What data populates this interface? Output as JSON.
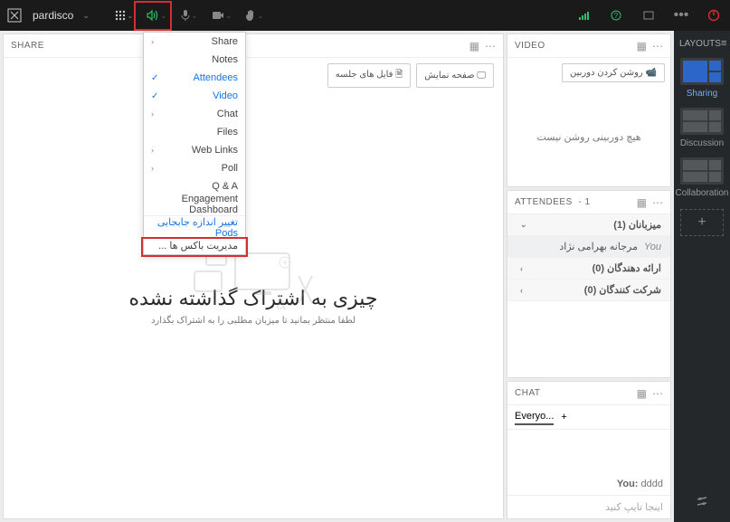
{
  "topbar": {
    "title": "pardisco",
    "icons": {
      "logo": "logo-icon",
      "pods": "grid-icon",
      "speaker": "speaker-icon",
      "mic": "mic-icon",
      "camera": "camera-icon",
      "hand": "hand-icon",
      "signal": "signal-icon",
      "help": "help-icon",
      "fullscreen": "fullscreen-icon",
      "more": "more-icon",
      "power": "power-icon"
    }
  },
  "layouts": {
    "head": "LAYOUTS",
    "items": [
      {
        "label": "Sharing",
        "active": true
      },
      {
        "label": "Discussion",
        "active": false
      },
      {
        "label": "Collaboration",
        "active": false
      }
    ]
  },
  "dropdown": {
    "items": [
      {
        "label": "Share",
        "arrow": true
      },
      {
        "label": "Notes"
      },
      {
        "label": "Attendees",
        "checked": true
      },
      {
        "label": "Video",
        "checked": true
      },
      {
        "label": "Chat",
        "arrow": true
      },
      {
        "label": "Files"
      },
      {
        "label": "Web Links",
        "arrow": true
      },
      {
        "label": "Poll",
        "arrow": true
      },
      {
        "label": "Q & A"
      },
      {
        "label": "Engagement Dashboard"
      }
    ],
    "extra1": "تغییر اندازه جابجایی Pods",
    "extra2": "مدیریت باکس ها ..."
  },
  "share": {
    "title": "SHARE",
    "btn1": "صفحه نمایش",
    "btn2": "فایل های جلسه",
    "heading": "چیزی به اشتراک گذاشته نشده",
    "sub": "لطفا منتظر بمانید تا میزبان مطلبی را به اشتراک بگذارد"
  },
  "video": {
    "title": "VIDEO",
    "btn": "روشن کردن دوربین",
    "empty": "هیچ دوربینی روشن نیست"
  },
  "attendees": {
    "title": "ATTENDEES",
    "count": "1",
    "groups": {
      "hosts": "میزبانان (1)",
      "presenters": "ارائه دهندگان (0)",
      "participants": "شرکت کنندگان (0)"
    },
    "you_label": "You",
    "user_name": "مرجانه بهرامی نژاد"
  },
  "chat": {
    "title": "CHAT",
    "tab": "Everyo...",
    "msg_user": "You:",
    "msg_text": "dddd",
    "placeholder": "اینجا تایپ کنید"
  }
}
